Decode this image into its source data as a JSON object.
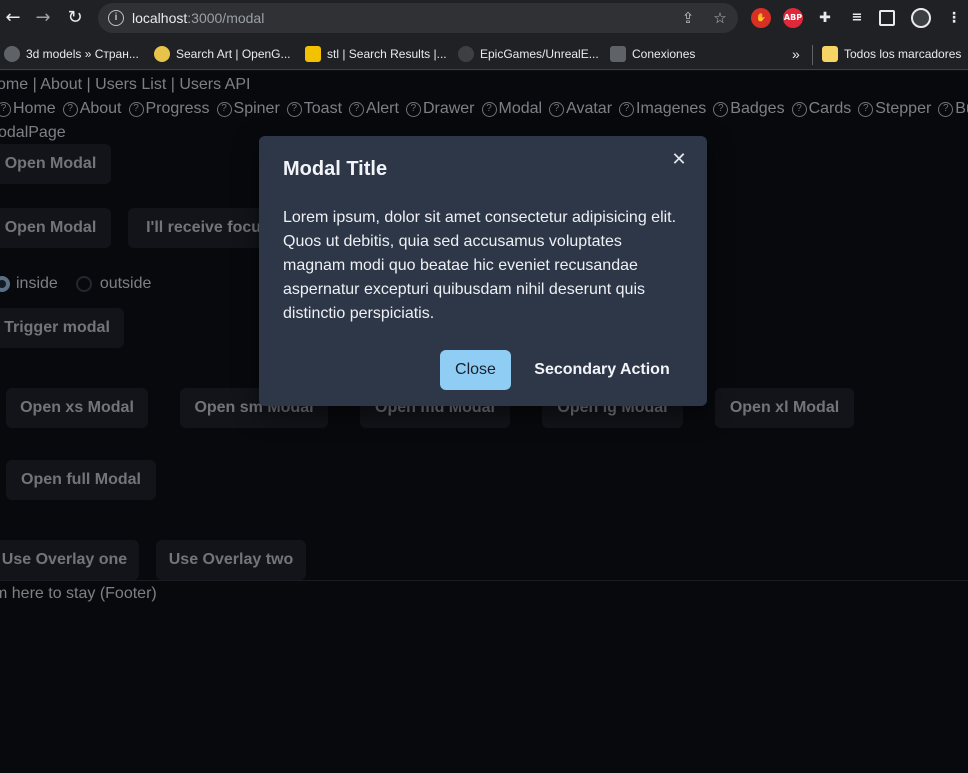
{
  "browser": {
    "url_host": "localhost",
    "url_path": ":3000/modal",
    "back_icon": "arrow-left-icon",
    "forward_icon": "arrow-right-icon",
    "reload_icon": "reload-icon",
    "extensions": [
      {
        "name": "hand-extension-icon",
        "label": "✋",
        "color": "#d93025"
      },
      {
        "name": "adblock-plus-icon",
        "label": "ABP",
        "color": "#e0283b"
      },
      {
        "name": "puzzle-extensions-icon",
        "label": "",
        "color": "#202124"
      }
    ],
    "bookmarks": [
      {
        "label": "3d models » Стран...",
        "color": "#5f6368"
      },
      {
        "label": "Search Art | OpenG...",
        "color": "#e8c34a"
      },
      {
        "label": "stl | Search Results |...",
        "color": "#f2c200"
      },
      {
        "label": "EpicGames/UnrealE...",
        "color": "#3c4043"
      },
      {
        "label": "Conexiones",
        "color": "#5f6368"
      }
    ],
    "more_bookmarks": "»",
    "all_bookmarks": "Todos los marcadores"
  },
  "page": {
    "top_links": "ome | About | Users List | Users API",
    "nav_items": [
      "Home",
      "About",
      "Progress",
      "Spiner",
      "Toast",
      "Alert",
      "Drawer",
      "Modal",
      "Avatar",
      "Imagenes",
      "Badges",
      "Cards",
      "Stepper",
      "Buttons"
    ],
    "page_title": "odalPage",
    "buttons": {
      "open_modal_1": "Open Modal",
      "open_modal_2": "Open Modal",
      "receive_focus": "I'll receive focus",
      "trigger_modal": "Trigger modal",
      "open_xs": "Open xs Modal",
      "open_sm": "Open sm Modal",
      "open_md": "Open md Modal",
      "open_lg": "Open lg Modal",
      "open_xl": "Open xl Modal",
      "open_full": "Open full Modal",
      "overlay_one": "Use Overlay one",
      "overlay_two": "Use Overlay two"
    },
    "radio": {
      "inside": "inside",
      "outside": "outside",
      "selected": "inside"
    },
    "footer": "m here to stay (Footer)"
  },
  "modal": {
    "title": "Modal Title",
    "close_icon": "close-icon",
    "body": "Lorem ipsum, dolor sit amet consectetur adipisicing elit. Quos ut debitis, quia sed accusamus voluptates magnam modi quo beatae hic eveniet recusandae aspernatur excepturi quibusdam nihil deserunt quis distinctio perspiciatis.",
    "primary": "Close",
    "secondary": "Secondary Action"
  }
}
